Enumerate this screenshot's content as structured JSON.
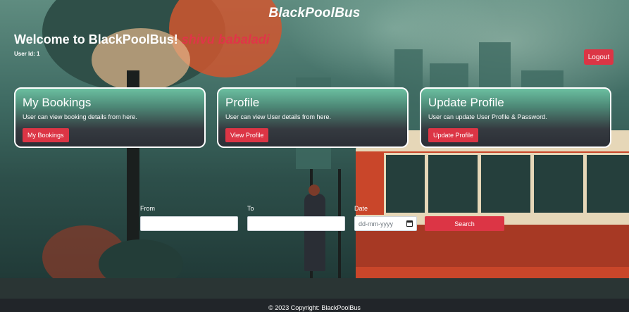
{
  "header": {
    "brand": "BlackPoolBus"
  },
  "welcome": {
    "greeting": "Welcome to BlackPoolBus!",
    "username": "shivu babaladi",
    "user_id": "User Id: 1"
  },
  "logout_label": "Logout",
  "cards": [
    {
      "title": "My Bookings",
      "description": "User can view booking details from here.",
      "button": "My Bookings"
    },
    {
      "title": "Profile",
      "description": "User can view User details from here.",
      "button": "View Profile"
    },
    {
      "title": "Update Profile",
      "description": "User can update User Profile & Password.",
      "button": "Update Profile"
    }
  ],
  "search": {
    "from_label": "From",
    "to_label": "To",
    "date_label": "Date",
    "from_value": "",
    "to_value": "",
    "date_placeholder": "dd-mm-yyyy",
    "button": "Search"
  },
  "footer": {
    "text": "© 2023 Copyright: BlackPoolBus"
  },
  "colors": {
    "accent": "#dc3545",
    "username": "#e03548",
    "footer_bg": "#212529"
  },
  "icons": {
    "date_picker": "calendar-icon"
  }
}
